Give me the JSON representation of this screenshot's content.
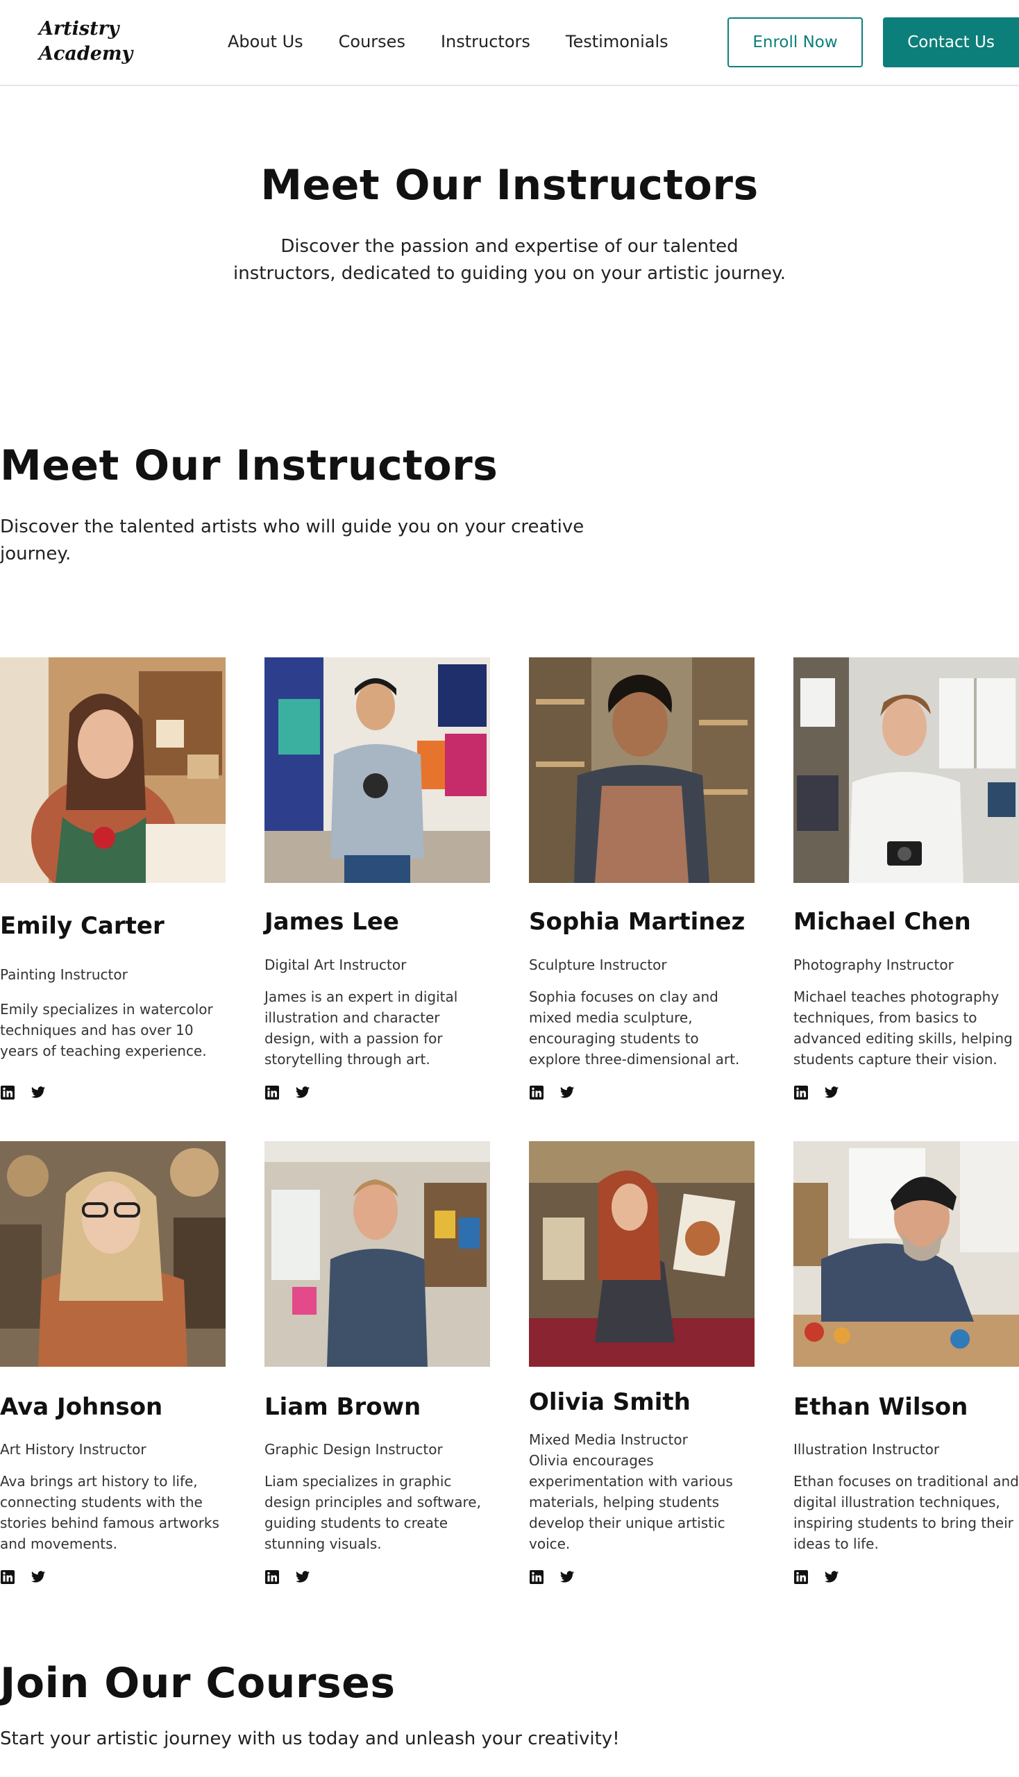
{
  "header": {
    "logo_line1": "Artistry",
    "logo_line2": "Academy",
    "nav": [
      "About Us",
      "Courses",
      "Instructors",
      "Testimonials"
    ],
    "enroll_label": "Enroll Now",
    "contact_label": "Contact Us"
  },
  "hero": {
    "title": "Meet Our Instructors",
    "subtitle": "Discover the passion and expertise of our talented instructors, dedicated to guiding you on your artistic journey."
  },
  "instructors_section": {
    "title": "Meet Our Instructors",
    "subtitle": "Discover the talented artists who will guide you on your creative journey."
  },
  "instructors": [
    {
      "name": "Emily Carter",
      "role": "Painting Instructor",
      "bio": "Emily specializes in watercolor techniques and has over 10 years of teaching experience."
    },
    {
      "name": "James Lee",
      "role": "Digital Art Instructor",
      "bio": "James is an expert in digital illustration and character design, with a passion for storytelling through art."
    },
    {
      "name": "Sophia Martinez",
      "role": "Sculpture Instructor",
      "bio": "Sophia focuses on clay and mixed media sculpture, encouraging students to explore three-dimensional art."
    },
    {
      "name": "Michael Chen",
      "role": "Photography Instructor",
      "bio": "Michael teaches photography techniques, from basics to advanced editing skills, helping students capture their vision."
    },
    {
      "name": "Ava Johnson",
      "role": "Art History Instructor",
      "bio": "Ava brings art history to life, connecting students with the stories behind famous artworks and movements."
    },
    {
      "name": "Liam Brown",
      "role": "Graphic Design Instructor",
      "bio": "Liam specializes in graphic design principles and software, guiding students to create stunning visuals."
    },
    {
      "name": "Olivia Smith",
      "role": "Mixed Media Instructor",
      "bio": "Olivia encourages experimentation with various materials, helping students develop their unique artistic voice."
    },
    {
      "name": "Ethan Wilson",
      "role": "Illustration Instructor",
      "bio": "Ethan focuses on traditional and digital illustration techniques, inspiring students to bring their ideas to life."
    }
  ],
  "join": {
    "title": "Join Our Courses",
    "subtitle": "Start your artistic journey with us today and unleash your creativity!"
  },
  "colors": {
    "accent": "#0d7f7a"
  }
}
